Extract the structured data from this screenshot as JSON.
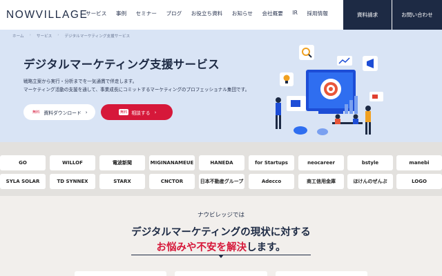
{
  "header": {
    "logo": "NOWVILLAGE",
    "nav": [
      "サービス",
      "事例",
      "セミナー",
      "ブログ",
      "お役立ち資料",
      "お知らせ",
      "会社概要",
      "IR",
      "採用情報"
    ],
    "btn_doc": "資料請求",
    "btn_contact": "お問い合わせ"
  },
  "hero": {
    "breadcrumb": [
      "ホーム",
      "サービス",
      "デジタルマーケティング支援サービス"
    ],
    "title": "デジタルマーケティング支援サービス",
    "desc1": "戦略立案から実行・分析までを一気通貫で伴走します。",
    "desc2": "マーケティング活動の支援を通して、事業成長にコミットするマーケティングのプロフェッショナル集団です。",
    "btn_download_badge": "無料",
    "btn_download": "資料ダウンロード",
    "btn_consult_badge": "無料",
    "btn_consult": "相談する",
    "chevron": "›"
  },
  "logos": {
    "row1": [
      "GO",
      "WILLOF",
      "電波新聞",
      "MIGINANAMEUE",
      "HANEDA",
      "for Startups",
      "neocareer",
      "bstyle",
      "manebi"
    ],
    "row2": [
      "SYLA SOLAR",
      "TD SYNNEX",
      "STARX",
      "CNCTOR",
      "日本不動産グループ",
      "Adecco",
      "商工信用金庫",
      "ほけんのぜんぷ",
      "LOGO"
    ]
  },
  "lower": {
    "kicker": "ナウビレッジでは",
    "title1": "デジタルマーケティングの現状に対する",
    "title2_accent": "お悩みや不安を解決",
    "title2_rest": "します。"
  },
  "colors": {
    "navy": "#1d2a44",
    "red": "#d6183a",
    "hero_bg": "#d9e4f5"
  }
}
